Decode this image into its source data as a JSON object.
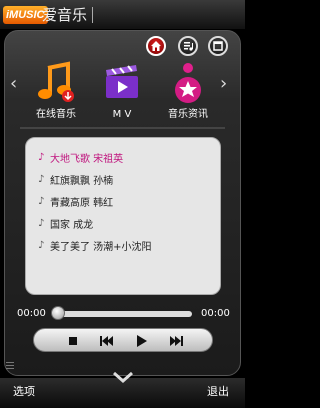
{
  "app": {
    "logo_text": "iMUSIC",
    "title": "爱音乐"
  },
  "top_buttons": [
    "home-icon",
    "playlist-icon",
    "window-icon"
  ],
  "categories": [
    {
      "label": "在线音乐",
      "icon": "music-note-icon",
      "selected": true
    },
    {
      "label": "M V",
      "icon": "clapperboard-icon",
      "selected": false
    },
    {
      "label": "音乐资讯",
      "icon": "star-news-icon",
      "selected": false
    }
  ],
  "songs": [
    {
      "title": "大地飞歌 宋祖英",
      "active": true
    },
    {
      "title": "紅旗飘飘 孙楠",
      "active": false
    },
    {
      "title": "青藏高原 韩红",
      "active": false
    },
    {
      "title": "国家 成龙",
      "active": false
    },
    {
      "title": "美了美了 汤潮+小沈阳",
      "active": false
    }
  ],
  "player": {
    "current_time": "00:00",
    "total_time": "00:00",
    "progress": 0
  },
  "colors": {
    "accent": "#c0157e",
    "home": "#d22222"
  },
  "softkeys": {
    "left": "选项",
    "right": "退出"
  }
}
